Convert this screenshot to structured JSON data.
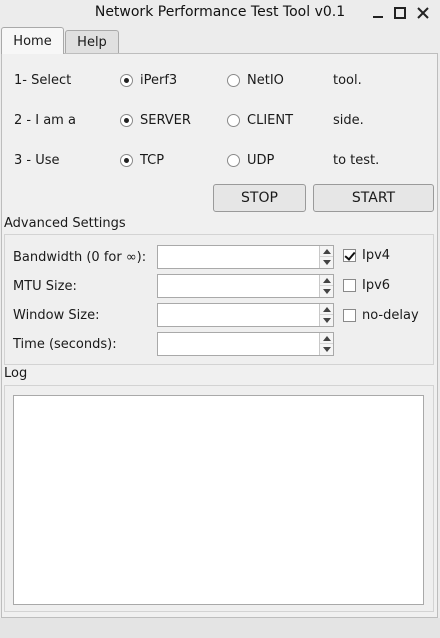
{
  "window": {
    "title": "Network Performance Test Tool v0.1",
    "controls": [
      "minimize-icon",
      "maximize-icon",
      "close-icon"
    ]
  },
  "tabs": [
    {
      "label": "Home",
      "active": true
    },
    {
      "label": "Help",
      "active": false
    }
  ],
  "rows": [
    {
      "label": "1-  Select",
      "options": [
        {
          "label": "iPerf3",
          "checked": true
        },
        {
          "label": "NetIO",
          "checked": false
        }
      ],
      "suffix": "tool."
    },
    {
      "label": "2 - I am a",
      "options": [
        {
          "label": "SERVER",
          "checked": true
        },
        {
          "label": "CLIENT",
          "checked": false
        }
      ],
      "suffix": "side."
    },
    {
      "label": "3 - Use",
      "options": [
        {
          "label": "TCP",
          "checked": true
        },
        {
          "label": "UDP",
          "checked": false
        }
      ],
      "suffix": "to test."
    }
  ],
  "buttons": {
    "stop": "STOP",
    "start": "START"
  },
  "advanced": {
    "title": "Advanced Settings",
    "fields": [
      {
        "label": "Bandwidth (0 for ∞):",
        "value": ""
      },
      {
        "label": "MTU Size:",
        "value": ""
      },
      {
        "label": "Window Size:",
        "value": ""
      },
      {
        "label": "Time (seconds):",
        "value": ""
      }
    ],
    "checkboxes": [
      {
        "label": "Ipv4",
        "checked": true
      },
      {
        "label": "Ipv6",
        "checked": false
      },
      {
        "label": "no-delay",
        "checked": false
      }
    ]
  },
  "log": {
    "title": "Log",
    "content": ""
  }
}
